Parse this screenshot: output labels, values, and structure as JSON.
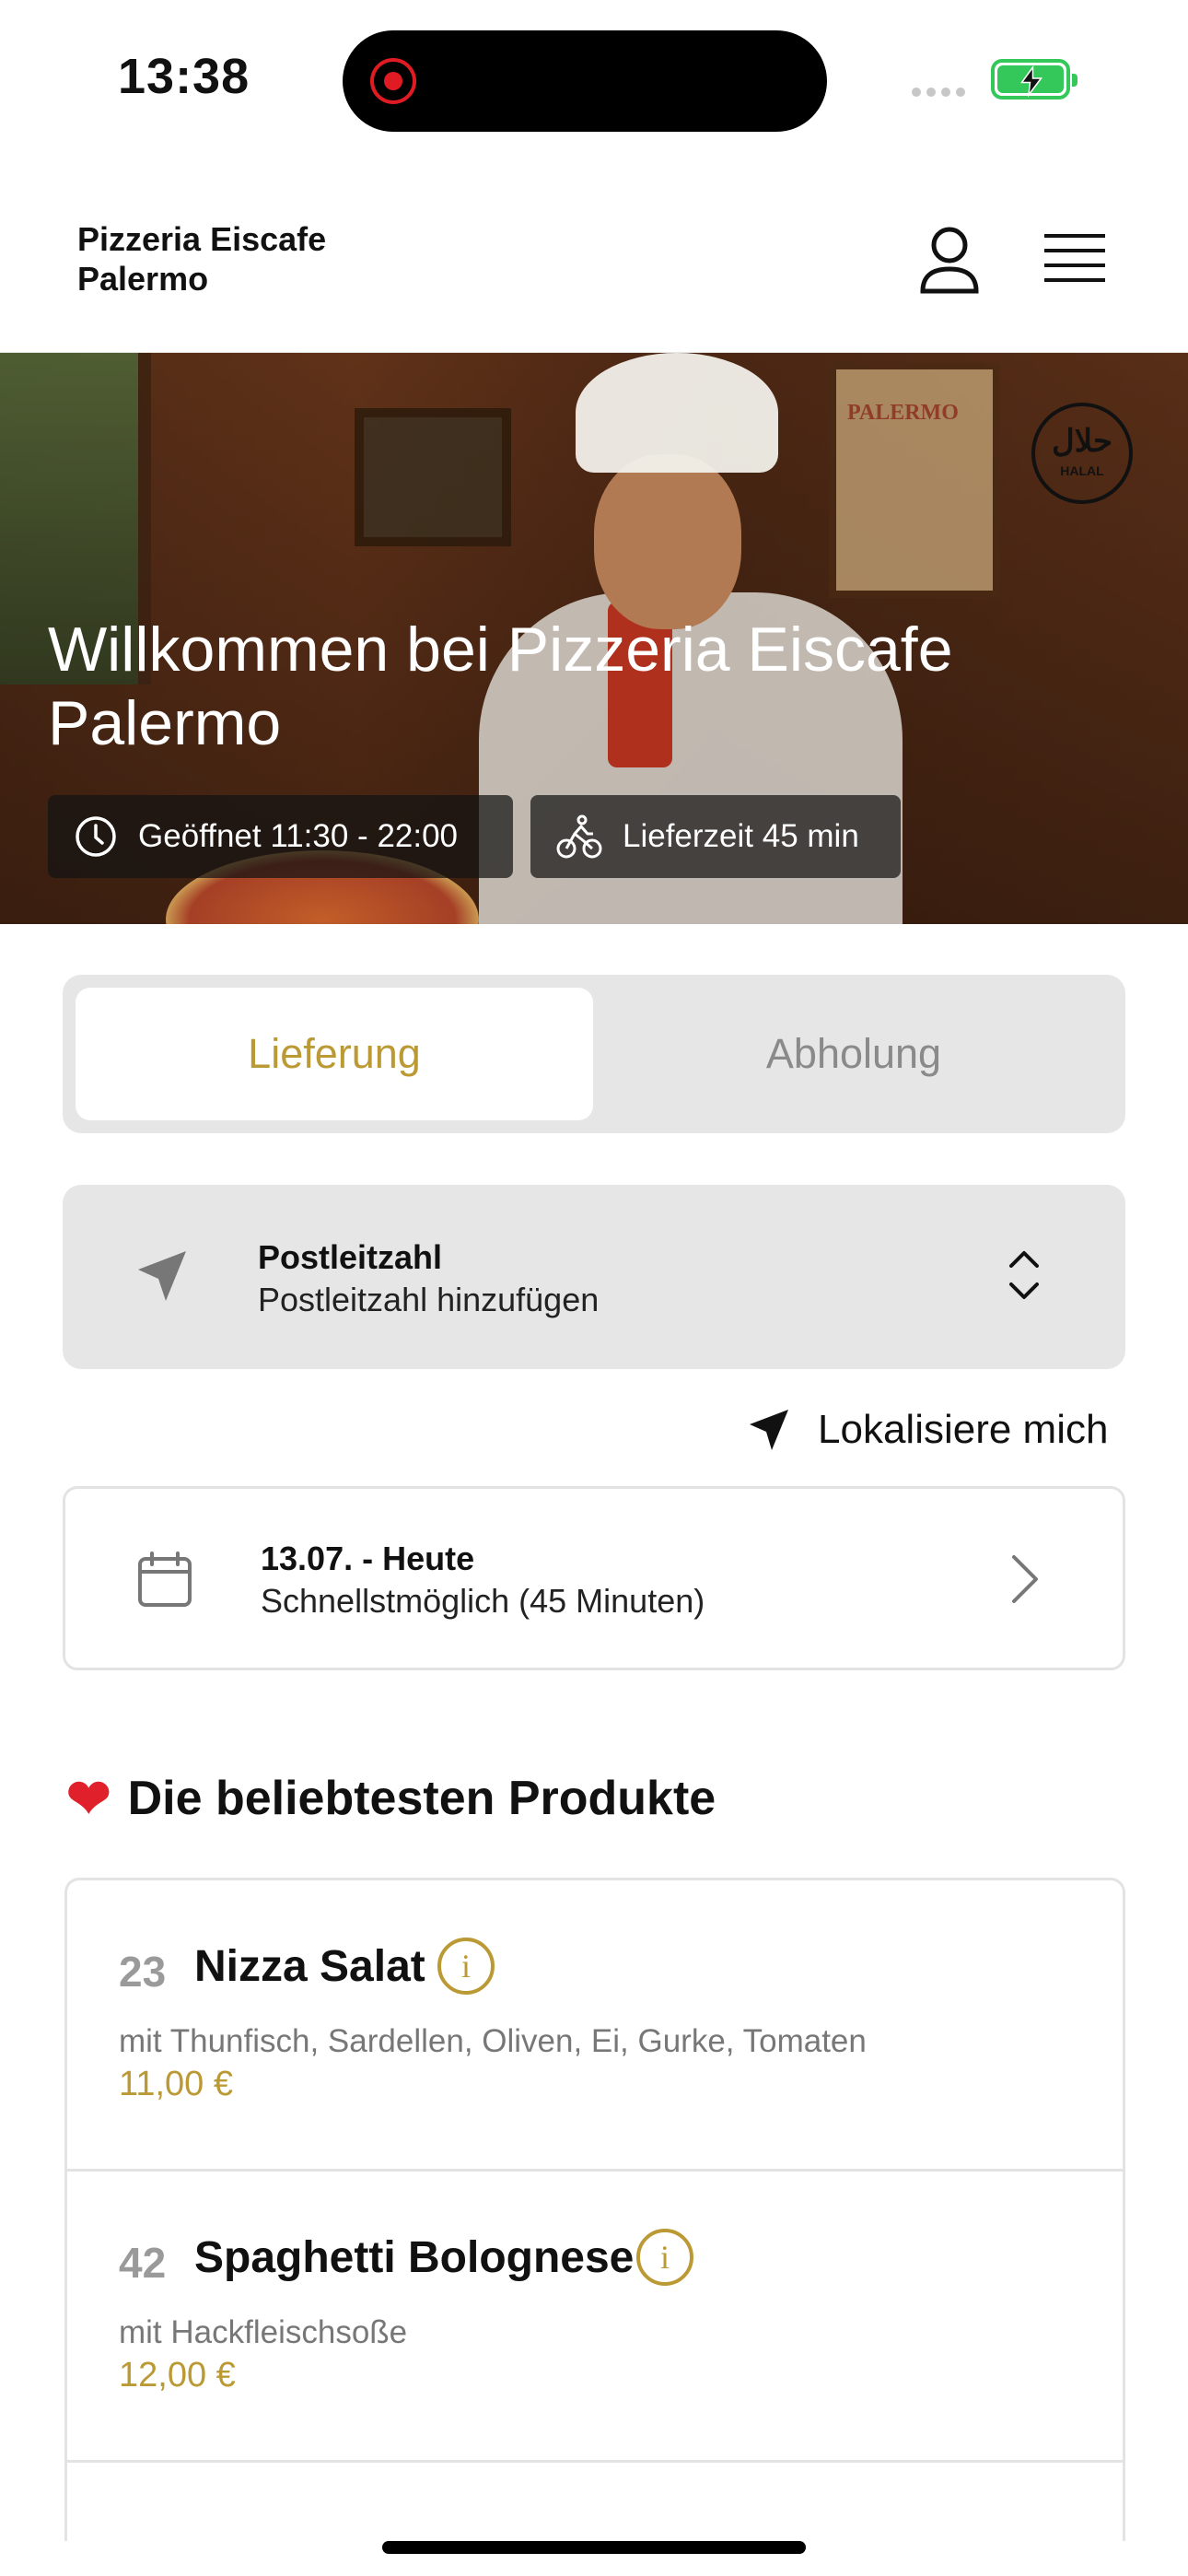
{
  "status_bar": {
    "time": "13:38"
  },
  "header": {
    "brand": "Pizzeria Eiscafe Palermo",
    "user_icon": "user-icon",
    "menu_icon": "hamburger-menu-icon"
  },
  "hero": {
    "title": "Willkommen bei Pizzeria Eiscafe Palermo",
    "opening_hours": "Geöffnet 11:30 - 22:00",
    "delivery_time": "Lieferzeit 45 min",
    "poster_text": "PALERMO",
    "halal_badge": {
      "arabic": "حلال",
      "latin": "HALAL"
    }
  },
  "order_mode": {
    "options": [
      "Lieferung",
      "Abholung"
    ],
    "selected": "Lieferung"
  },
  "postcode": {
    "label": "Postleitzahl",
    "placeholder": "Postleitzahl hinzufügen"
  },
  "locate": {
    "label": "Lokalisiere mich"
  },
  "date": {
    "day": "13.07. - Heute",
    "time": "Schnellstmöglich (45 Minuten)"
  },
  "popular": {
    "title": "Die beliebtesten Produkte",
    "products": [
      {
        "number": "23",
        "name": "Nizza Salat",
        "description": "mit Thunfisch, Sardellen, Oliven, Ei, Gurke, Tomaten",
        "price": "11,00 €"
      },
      {
        "number": "42",
        "name": "Spaghetti Bolognese",
        "description": "mit Hackfleischsoße",
        "price": "12,00 €"
      }
    ]
  },
  "colors": {
    "accent": "#bb9a35",
    "toggle_bg": "#e6e6e6",
    "battery": "#34c759",
    "record": "#e01b24"
  }
}
